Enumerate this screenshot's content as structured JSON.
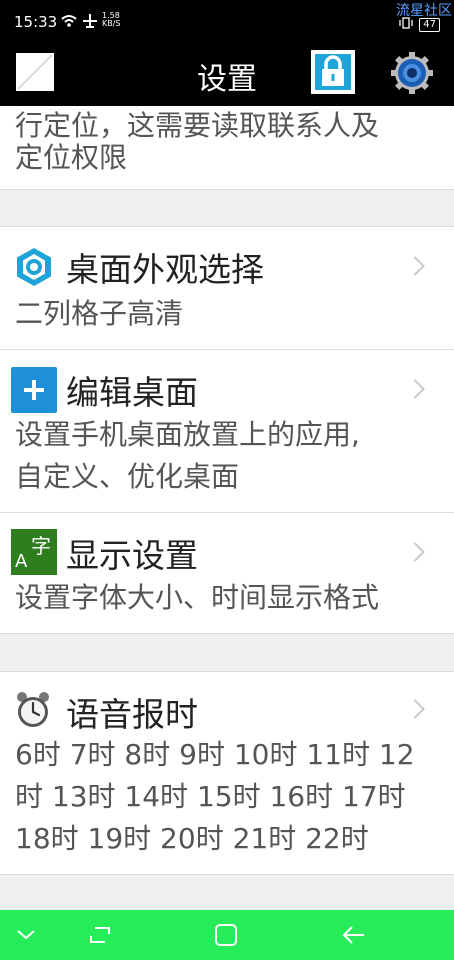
{
  "status_bar": {
    "time": "15:33",
    "speed_value": "1.58",
    "speed_unit": "KB/S",
    "battery": "47",
    "watermark": "流星社区"
  },
  "header": {
    "title": "设置",
    "icons": [
      "image-placeholder-icon",
      "lock-icon",
      "gear-icon"
    ],
    "accent_color": "#1ea4d8"
  },
  "top_partial": {
    "text_line1": "行定位，这需要读取联系人及",
    "text_line2": "定位权限"
  },
  "items": [
    {
      "icon": "hexagon-gear-icon",
      "title": "桌面外观选择",
      "desc": [
        "二列格子高清"
      ]
    },
    {
      "icon": "plus-icon",
      "title": "编辑桌面",
      "desc": [
        "设置手机桌面放置上的应用,",
        "自定义、优化桌面"
      ]
    },
    {
      "icon": "font-icon",
      "title": "显示设置",
      "desc": [
        "设置字体大小、时间显示格式"
      ]
    },
    {
      "icon": "alarm-clock-icon",
      "title": "语音报时",
      "desc": [
        "6时 7时 8时 9时 10时 11时 12",
        "时 13时 14时 15时 16时 17时",
        "18时 19时 20时 21时 22时"
      ]
    }
  ],
  "colors": {
    "nav_bar": "#27ec5a",
    "font_icon_bg": "#2e7d1f",
    "plus_icon_bg": "#1e90d8"
  }
}
